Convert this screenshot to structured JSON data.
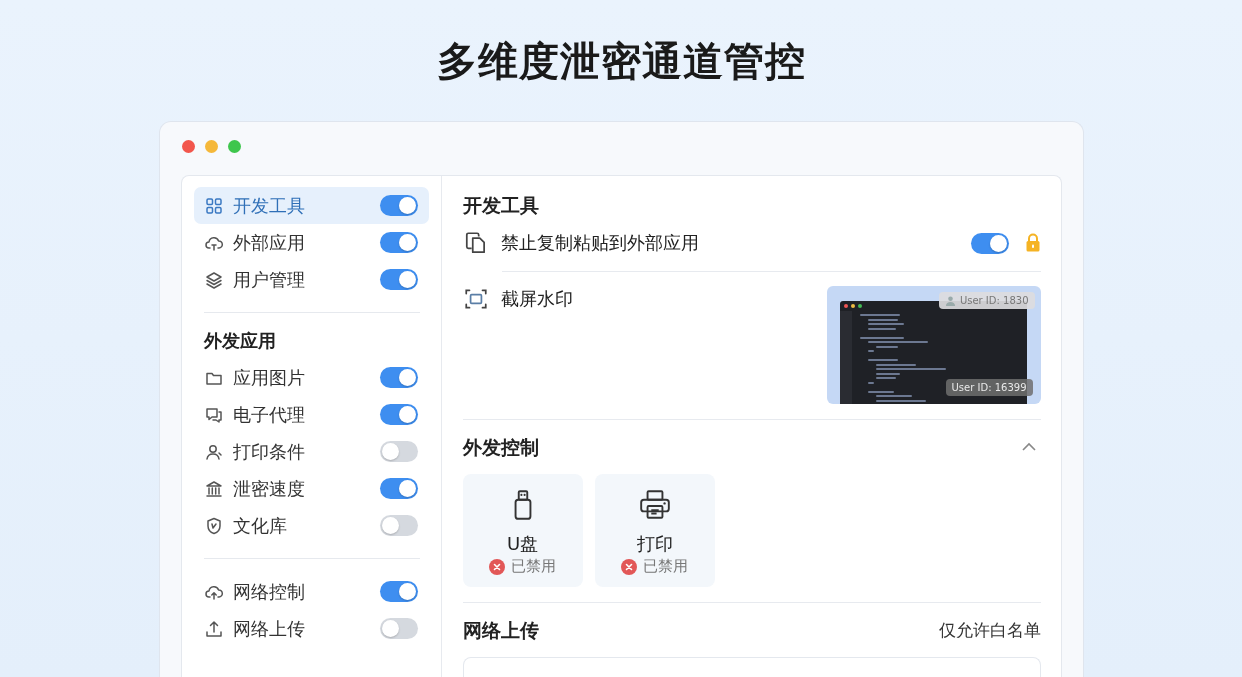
{
  "page_title": "多维度泄密通道管控",
  "sidebar": {
    "groups": [
      {
        "items": [
          {
            "label": "开发工具",
            "on": true,
            "selected": true
          },
          {
            "label": "外部应用",
            "on": true,
            "selected": false
          },
          {
            "label": "用户管理",
            "on": true,
            "selected": false
          }
        ]
      },
      {
        "heading": "外发应用",
        "items": [
          {
            "label": "应用图片",
            "on": true,
            "selected": false
          },
          {
            "label": "电子代理",
            "on": true,
            "selected": false
          },
          {
            "label": "打印条件",
            "on": false,
            "selected": false
          },
          {
            "label": "泄密速度",
            "on": true,
            "selected": false
          },
          {
            "label": "文化库",
            "on": false,
            "selected": false
          }
        ]
      },
      {
        "items": [
          {
            "label": "网络控制",
            "on": true,
            "selected": false
          },
          {
            "label": "网络上传",
            "on": false,
            "selected": false
          }
        ]
      }
    ]
  },
  "dev_tools": {
    "heading": "开发工具",
    "copy_paste": {
      "label": "禁止复制粘贴到外部应用",
      "on": true,
      "locked": true
    },
    "watermark": {
      "label": "截屏水印",
      "preview_labels": [
        "User ID: 1830",
        "User ID: 16399"
      ]
    }
  },
  "outbound": {
    "heading": "外发控制",
    "expanded": true,
    "devices": [
      {
        "label": "U盘",
        "status": "已禁用",
        "disabled": true
      },
      {
        "label": "打印",
        "status": "已禁用",
        "disabled": true
      }
    ]
  },
  "upload": {
    "heading": "网络上传",
    "mode": "仅允许白名单"
  }
}
